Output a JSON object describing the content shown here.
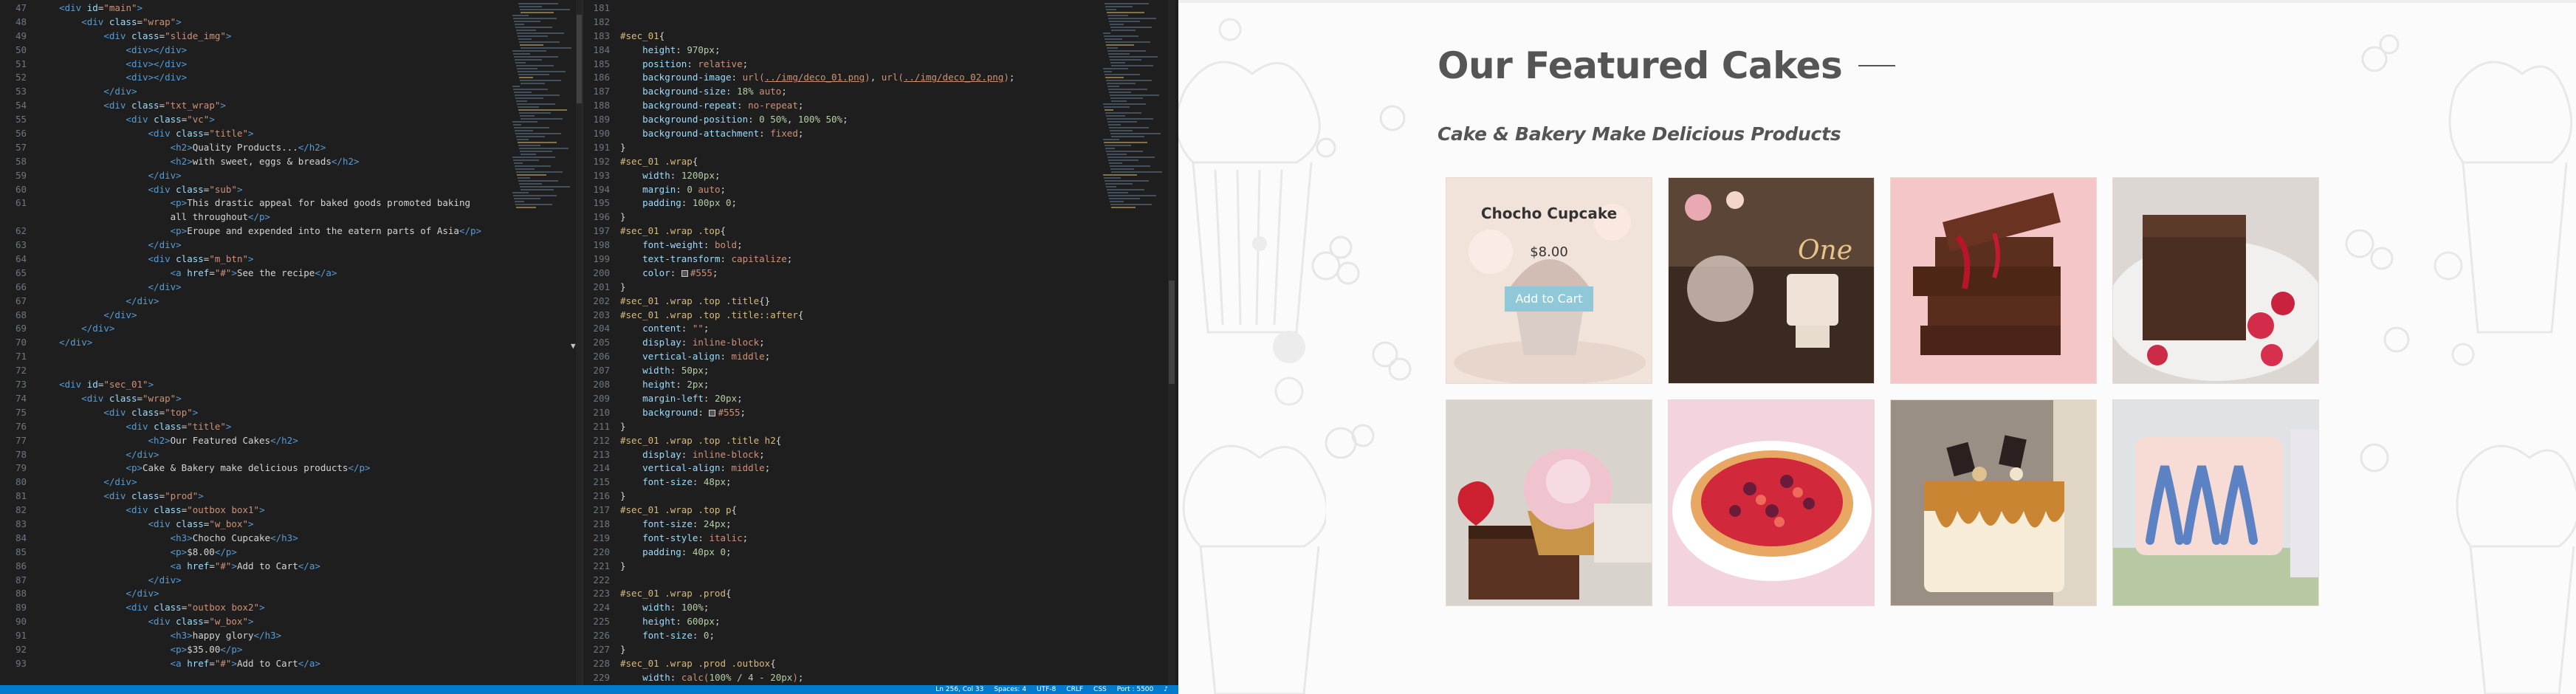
{
  "editor": {
    "html_lines": [
      {
        "n": "47",
        "html": "<span class='t-punc'>    </span><span class='t-tag'>&lt;div</span> <span class='t-attr'>id</span>=<span class='t-str'>\"main\"</span><span class='t-tag'>&gt;</span>"
      },
      {
        "n": "48",
        "html": "        <span class='t-tag'>&lt;div</span> <span class='t-attr'>class</span>=<span class='t-str'>\"wrap\"</span><span class='t-tag'>&gt;</span>"
      },
      {
        "n": "49",
        "html": "            <span class='t-tag'>&lt;div</span> <span class='t-attr'>class</span>=<span class='t-str'>\"slide_img\"</span><span class='t-tag'>&gt;</span>"
      },
      {
        "n": "50",
        "html": "                <span class='t-tag'>&lt;div&gt;&lt;/div&gt;</span>"
      },
      {
        "n": "51",
        "html": "                <span class='t-tag'>&lt;div&gt;&lt;/div&gt;</span>"
      },
      {
        "n": "52",
        "html": "                <span class='t-tag'>&lt;div&gt;&lt;/div&gt;</span>"
      },
      {
        "n": "53",
        "html": "            <span class='t-tag'>&lt;/div&gt;</span>"
      },
      {
        "n": "54",
        "html": "            <span class='t-tag'>&lt;div</span> <span class='t-attr'>class</span>=<span class='t-str'>\"txt_wrap\"</span><span class='t-tag'>&gt;</span>"
      },
      {
        "n": "55",
        "html": "                <span class='t-tag'>&lt;div</span> <span class='t-attr'>class</span>=<span class='t-str'>\"vc\"</span><span class='t-tag'>&gt;</span>"
      },
      {
        "n": "56",
        "html": "                    <span class='t-tag'>&lt;div</span> <span class='t-attr'>class</span>=<span class='t-str'>\"title\"</span><span class='t-tag'>&gt;</span>"
      },
      {
        "n": "57",
        "html": "                        <span class='t-tag'>&lt;h2&gt;</span>Quality Products...<span class='t-tag'>&lt;/h2&gt;</span>"
      },
      {
        "n": "58",
        "html": "                        <span class='t-tag'>&lt;h2&gt;</span>with sweet, eggs &amp; breads<span class='t-tag'>&lt;/h2&gt;</span>"
      },
      {
        "n": "59",
        "html": "                    <span class='t-tag'>&lt;/div&gt;</span>"
      },
      {
        "n": "60",
        "html": "                    <span class='t-tag'>&lt;div</span> <span class='t-attr'>class</span>=<span class='t-str'>\"sub\"</span><span class='t-tag'>&gt;</span>"
      },
      {
        "n": "61",
        "html": "                        <span class='t-tag'>&lt;p&gt;</span>This drastic appeal for baked goods promoted baking"
      },
      {
        "n": "",
        "html": "                        all throughout<span class='t-tag'>&lt;/p&gt;</span>"
      },
      {
        "n": "62",
        "html": "                        <span class='t-tag'>&lt;p&gt;</span>Eroupe and expended into the eatern parts of Asia<span class='t-tag'>&lt;/p&gt;</span>"
      },
      {
        "n": "63",
        "html": "                    <span class='t-tag'>&lt;/div&gt;</span>"
      },
      {
        "n": "64",
        "html": "                    <span class='t-tag'>&lt;div</span> <span class='t-attr'>class</span>=<span class='t-str'>\"m_btn\"</span><span class='t-tag'>&gt;</span>"
      },
      {
        "n": "65",
        "html": "                        <span class='t-tag'>&lt;a</span> <span class='t-attr'>href</span>=<span class='t-str'>\"#\"</span><span class='t-tag'>&gt;</span>See the recipe<span class='t-tag'>&lt;/a&gt;</span>"
      },
      {
        "n": "66",
        "html": "                    <span class='t-tag'>&lt;/div&gt;</span>"
      },
      {
        "n": "67",
        "html": "                <span class='t-tag'>&lt;/div&gt;</span>"
      },
      {
        "n": "68",
        "html": "            <span class='t-tag'>&lt;/div&gt;</span>"
      },
      {
        "n": "69",
        "html": "        <span class='t-tag'>&lt;/div&gt;</span>"
      },
      {
        "n": "70",
        "html": "    <span class='t-tag'>&lt;/div&gt;</span>"
      },
      {
        "n": "71",
        "html": ""
      },
      {
        "n": "72",
        "html": ""
      },
      {
        "n": "73",
        "html": "    <span class='t-tag'>&lt;div</span> <span class='t-attr'>id</span>=<span class='t-str'>\"sec_01\"</span><span class='t-tag'>&gt;</span>"
      },
      {
        "n": "74",
        "html": "        <span class='t-tag'>&lt;div</span> <span class='t-attr'>class</span>=<span class='t-str'>\"wrap\"</span><span class='t-tag'>&gt;</span>"
      },
      {
        "n": "75",
        "html": "            <span class='t-tag'>&lt;div</span> <span class='t-attr'>class</span>=<span class='t-str'>\"top\"</span><span class='t-tag'>&gt;</span>"
      },
      {
        "n": "76",
        "html": "                <span class='t-tag'>&lt;div</span> <span class='t-attr'>class</span>=<span class='t-str'>\"title\"</span><span class='t-tag'>&gt;</span>"
      },
      {
        "n": "77",
        "html": "                    <span class='t-tag'>&lt;h2&gt;</span>Our Featured Cakes<span class='t-tag'>&lt;/h2&gt;</span>"
      },
      {
        "n": "78",
        "html": "                <span class='t-tag'>&lt;/div&gt;</span>"
      },
      {
        "n": "79",
        "html": "                <span class='t-tag'>&lt;p&gt;</span>Cake &amp; Bakery make delicious products<span class='t-tag'>&lt;/p&gt;</span>"
      },
      {
        "n": "80",
        "html": "            <span class='t-tag'>&lt;/div&gt;</span>"
      },
      {
        "n": "81",
        "html": "            <span class='t-tag'>&lt;div</span> <span class='t-attr'>class</span>=<span class='t-str'>\"prod\"</span><span class='t-tag'>&gt;</span>"
      },
      {
        "n": "82",
        "html": "                <span class='t-tag'>&lt;div</span> <span class='t-attr'>class</span>=<span class='t-str'>\"outbox box1\"</span><span class='t-tag'>&gt;</span>"
      },
      {
        "n": "83",
        "html": "                    <span class='t-tag'>&lt;div</span> <span class='t-attr'>class</span>=<span class='t-str'>\"w_box\"</span><span class='t-tag'>&gt;</span>"
      },
      {
        "n": "84",
        "html": "                        <span class='t-tag'>&lt;h3&gt;</span>Chocho Cupcake<span class='t-tag'>&lt;/h3&gt;</span>"
      },
      {
        "n": "85",
        "html": "                        <span class='t-tag'>&lt;p&gt;</span>$8.00<span class='t-tag'>&lt;/p&gt;</span>"
      },
      {
        "n": "86",
        "html": "                        <span class='t-tag'>&lt;a</span> <span class='t-attr'>href</span>=<span class='t-str'>\"#\"</span><span class='t-tag'>&gt;</span>Add to Cart<span class='t-tag'>&lt;/a&gt;</span>"
      },
      {
        "n": "87",
        "html": "                    <span class='t-tag'>&lt;/div&gt;</span>"
      },
      {
        "n": "88",
        "html": "                <span class='t-tag'>&lt;/div&gt;</span>"
      },
      {
        "n": "89",
        "html": "                <span class='t-tag'>&lt;div</span> <span class='t-attr'>class</span>=<span class='t-str'>\"outbox box2\"</span><span class='t-tag'>&gt;</span>"
      },
      {
        "n": "90",
        "html": "                    <span class='t-tag'>&lt;div</span> <span class='t-attr'>class</span>=<span class='t-str'>\"w_box\"</span><span class='t-tag'>&gt;</span>"
      },
      {
        "n": "91",
        "html": "                        <span class='t-tag'>&lt;h3&gt;</span>happy glory<span class='t-tag'>&lt;/h3&gt;</span>"
      },
      {
        "n": "92",
        "html": "                        <span class='t-tag'>&lt;p&gt;</span>$35.00<span class='t-tag'>&lt;/p&gt;</span>"
      },
      {
        "n": "93",
        "html": "                        <span class='t-tag'>&lt;a</span> <span class='t-attr'>href</span>=<span class='t-str'>\"#\"</span><span class='t-tag'>&gt;</span>Add to Cart<span class='t-tag'>&lt;/a&gt;</span>"
      }
    ],
    "css_lines": [
      {
        "n": "181",
        "html": ""
      },
      {
        "n": "182",
        "html": ""
      },
      {
        "n": "183",
        "html": "<span class='t-sel'>#sec_01</span>{"
      },
      {
        "n": "184",
        "html": "    <span class='t-prop'>height</span>: <span class='t-num'>970px</span>;"
      },
      {
        "n": "185",
        "html": "    <span class='t-prop'>position</span>: <span class='t-str'>relative</span>;"
      },
      {
        "n": "186",
        "html": "    <span class='t-prop'>background-image</span>: <span class='t-str'>url(</span><span class='t-url'>../img/deco_01.png</span><span class='t-str'>)</span>, <span class='t-str'>url(</span><span class='t-url'>../img/deco_02.png</span><span class='t-str'>)</span>;"
      },
      {
        "n": "187",
        "html": "    <span class='t-prop'>background-size</span>: <span class='t-num'>18%</span> <span class='t-str'>auto</span>;"
      },
      {
        "n": "188",
        "html": "    <span class='t-prop'>background-repeat</span>: <span class='t-str'>no-repeat</span>;"
      },
      {
        "n": "189",
        "html": "    <span class='t-prop'>background-position</span>: <span class='t-num'>0 50%</span>, <span class='t-num'>100% 50%</span>;"
      },
      {
        "n": "190",
        "html": "    <span class='t-prop'>background-attachment</span>: <span class='t-str'>fixed</span>;"
      },
      {
        "n": "191",
        "html": "}"
      },
      {
        "n": "192",
        "html": "<span class='t-sel'>#sec_01 .wrap</span>{"
      },
      {
        "n": "193",
        "html": "    <span class='t-prop'>width</span>: <span class='t-num'>1200px</span>;"
      },
      {
        "n": "194",
        "html": "    <span class='t-prop'>margin</span>: <span class='t-num'>0</span> <span class='t-str'>auto</span>;"
      },
      {
        "n": "195",
        "html": "    <span class='t-prop'>padding</span>: <span class='t-num'>100px 0</span>;"
      },
      {
        "n": "196",
        "html": "}"
      },
      {
        "n": "197",
        "html": "<span class='t-sel'>#sec_01 .wrap .top</span>{"
      },
      {
        "n": "198",
        "html": "    <span class='t-prop'>font-weight</span>: <span class='t-str'>bold</span>;"
      },
      {
        "n": "199",
        "html": "    <span class='t-prop'>text-transform</span>: <span class='t-str'>capitalize</span>;"
      },
      {
        "n": "200",
        "html": "    <span class='t-prop'>color</span>: <span class='swatch'></span><span class='t-str'>#555</span>;"
      },
      {
        "n": "201",
        "html": "}"
      },
      {
        "n": "202",
        "html": "<span class='t-sel'>#sec_01 .wrap .top .title</span>{}"
      },
      {
        "n": "203",
        "html": "<span class='t-sel'>#sec_01 .wrap .top .title::after</span>{"
      },
      {
        "n": "204",
        "html": "    <span class='t-prop'>content</span>: <span class='t-str'>\"\"</span>;"
      },
      {
        "n": "205",
        "html": "    <span class='t-prop'>display</span>: <span class='t-str'>inline-block</span>;"
      },
      {
        "n": "206",
        "html": "    <span class='t-prop'>vertical-align</span>: <span class='t-str'>middle</span>;"
      },
      {
        "n": "207",
        "html": "    <span class='t-prop'>width</span>: <span class='t-num'>50px</span>;"
      },
      {
        "n": "208",
        "html": "    <span class='t-prop'>height</span>: <span class='t-num'>2px</span>;"
      },
      {
        "n": "209",
        "html": "    <span class='t-prop'>margin-left</span>: <span class='t-num'>20px</span>;"
      },
      {
        "n": "210",
        "html": "    <span class='t-prop'>background</span>: <span class='swatch'></span><span class='t-str'>#555</span>;"
      },
      {
        "n": "211",
        "html": "}"
      },
      {
        "n": "212",
        "html": "<span class='t-sel'>#sec_01 .wrap .top .title h2</span>{"
      },
      {
        "n": "213",
        "html": "    <span class='t-prop'>display</span>: <span class='t-str'>inline-block</span>;"
      },
      {
        "n": "214",
        "html": "    <span class='t-prop'>vertical-align</span>: <span class='t-str'>middle</span>;"
      },
      {
        "n": "215",
        "html": "    <span class='t-prop'>font-size</span>: <span class='t-num'>48px</span>;"
      },
      {
        "n": "216",
        "html": "}"
      },
      {
        "n": "217",
        "html": "<span class='t-sel'>#sec_01 .wrap .top p</span>{"
      },
      {
        "n": "218",
        "html": "    <span class='t-prop'>font-size</span>: <span class='t-num'>24px</span>;"
      },
      {
        "n": "219",
        "html": "    <span class='t-prop'>font-style</span>: <span class='t-str'>italic</span>;"
      },
      {
        "n": "220",
        "html": "    <span class='t-prop'>padding</span>: <span class='t-num'>40px 0</span>;"
      },
      {
        "n": "221",
        "html": "}"
      },
      {
        "n": "222",
        "html": ""
      },
      {
        "n": "223",
        "html": "<span class='t-sel'>#sec_01 .wrap .prod</span>{"
      },
      {
        "n": "224",
        "html": "    <span class='t-prop'>width</span>: <span class='t-num'>100%</span>;"
      },
      {
        "n": "225",
        "html": "    <span class='t-prop'>height</span>: <span class='t-num'>600px</span>;"
      },
      {
        "n": "226",
        "html": "    <span class='t-prop'>font-size</span>: <span class='t-num'>0</span>;"
      },
      {
        "n": "227",
        "html": "}"
      },
      {
        "n": "228",
        "html": "<span class='t-sel'>#sec_01 .wrap .prod .outbox</span>{"
      },
      {
        "n": "229",
        "html": "    <span class='t-prop'>width</span>: <span class='t-str'>calc(</span><span class='t-num'>100% / 4 - 20px</span><span class='t-str'>)</span>;"
      }
    ],
    "status": {
      "position": "Ln 256, Col 33",
      "spaces": "Spaces: 4",
      "encoding": "UTF-8",
      "eol": "CRLF",
      "language": "CSS",
      "port": "Port : 5500"
    }
  },
  "preview": {
    "title": "Our Featured Cakes",
    "subtitle": "Cake & Bakery Make Delicious Products",
    "featured": {
      "name": "Chocho Cupcake",
      "price": "$8.00",
      "button": "Add to Cart"
    },
    "colors": {
      "text": "#555555",
      "button": "#8fc9d8",
      "background": "#fbfbfb"
    },
    "products": [
      {
        "photo": "chocolate-cupcake"
      },
      {
        "photo": "one-birthday-cake"
      },
      {
        "photo": "chocolate-bar-stack"
      },
      {
        "photo": "brownie-raspberries"
      },
      {
        "photo": "brownie-cupcake-plate"
      },
      {
        "photo": "berry-tart"
      },
      {
        "photo": "caramel-drip-cake"
      },
      {
        "photo": "blue-frosting-cake"
      }
    ]
  }
}
